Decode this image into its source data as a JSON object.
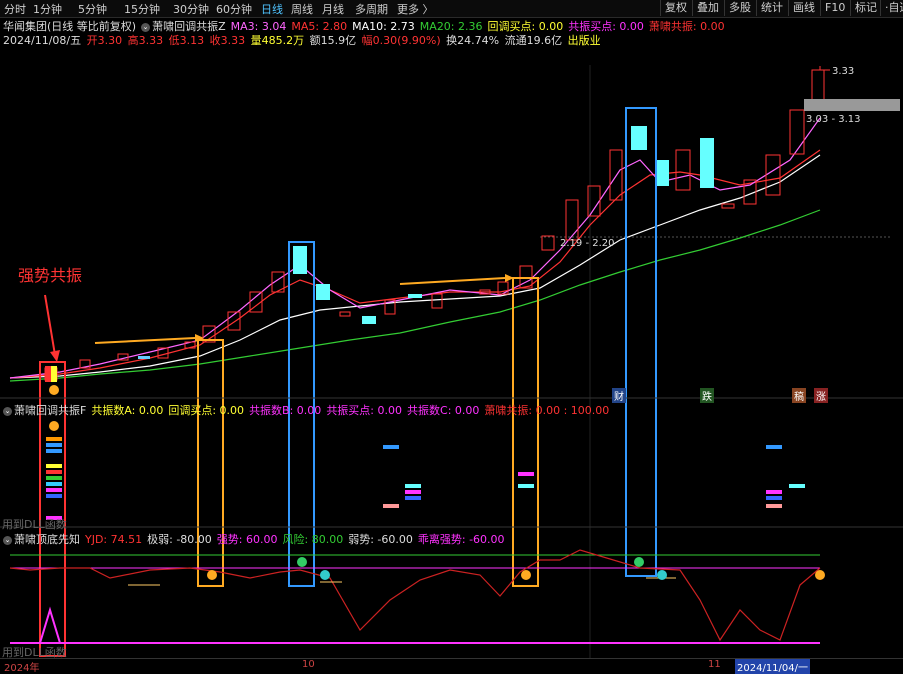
{
  "toolbar": {
    "tabs": [
      "分时",
      "1分钟",
      "5分钟",
      "15分钟",
      "30分钟",
      "60分钟",
      "日线",
      "周线",
      "月线",
      "多周期",
      "更多 〉"
    ],
    "active_tab": "日线",
    "right_buttons": [
      "复权",
      "叠加",
      "多股",
      "统计",
      "画线",
      "F10",
      "标记",
      "·自选"
    ]
  },
  "title_row": {
    "stock": "华闻集团(日线 等比前复权)",
    "indicator": "萧啸回调共振Z",
    "ma3": "MA3: 3.04",
    "ma5": "MA5: 2.80",
    "ma10": "MA10: 2.73",
    "ma20": "MA20: 2.36",
    "pullback": "回调买点: 0.00",
    "resonance_buy": "共振买点: 0.00",
    "xx_resonance": "萧啸共振: 0.00",
    "ma3_color": "#ff66ff",
    "ma5_color": "#ff3333",
    "ma10_color": "#ffffff",
    "ma20_color": "#33cc33"
  },
  "info_row": {
    "date": "2024/11/08/五",
    "open": "开3.30",
    "high": "高3.33",
    "low": "低3.13",
    "close": "收3.33",
    "volume": "量485.2万",
    "amount": "额15.9亿",
    "change": "幅0.30(9.90%)",
    "turnover": "换24.74%",
    "float": "流通19.6亿",
    "sector": "出版业"
  },
  "main_chart": {
    "price_high": "3.33",
    "range_top": "3.03 - 3.13",
    "range_mid": "2.19 - 2.20",
    "annotation": "强势共振",
    "used_label": "用到DLL函数"
  },
  "panel2": {
    "name": "萧啸回调共振F",
    "a": "共振数A: 0.00",
    "pullback": "回调买点: 0.00",
    "b": "共振数B: 0.00",
    "resonance": "共振买点: 0.00",
    "c": "共振数C: 0.00",
    "xx": "萧啸共振: 0.00 : 100.00",
    "used_label": "用到DLL函数"
  },
  "panel3": {
    "name": "萧啸顶底先知",
    "yjd": "YJD: 74.51",
    "weak_ext": "极弱: -80.00",
    "strong": "强势: 60.00",
    "risk": "风险: 80.00",
    "weak": "弱势: -60.00",
    "dev": "乖离强势: -60.00",
    "used_label": "用到DLL函数"
  },
  "tags": [
    "财",
    "跌",
    "稿",
    "涨"
  ],
  "x_axis": {
    "year": "2024年",
    "m10": "10",
    "m11": "11",
    "date": "2024/11/04/一"
  }
}
